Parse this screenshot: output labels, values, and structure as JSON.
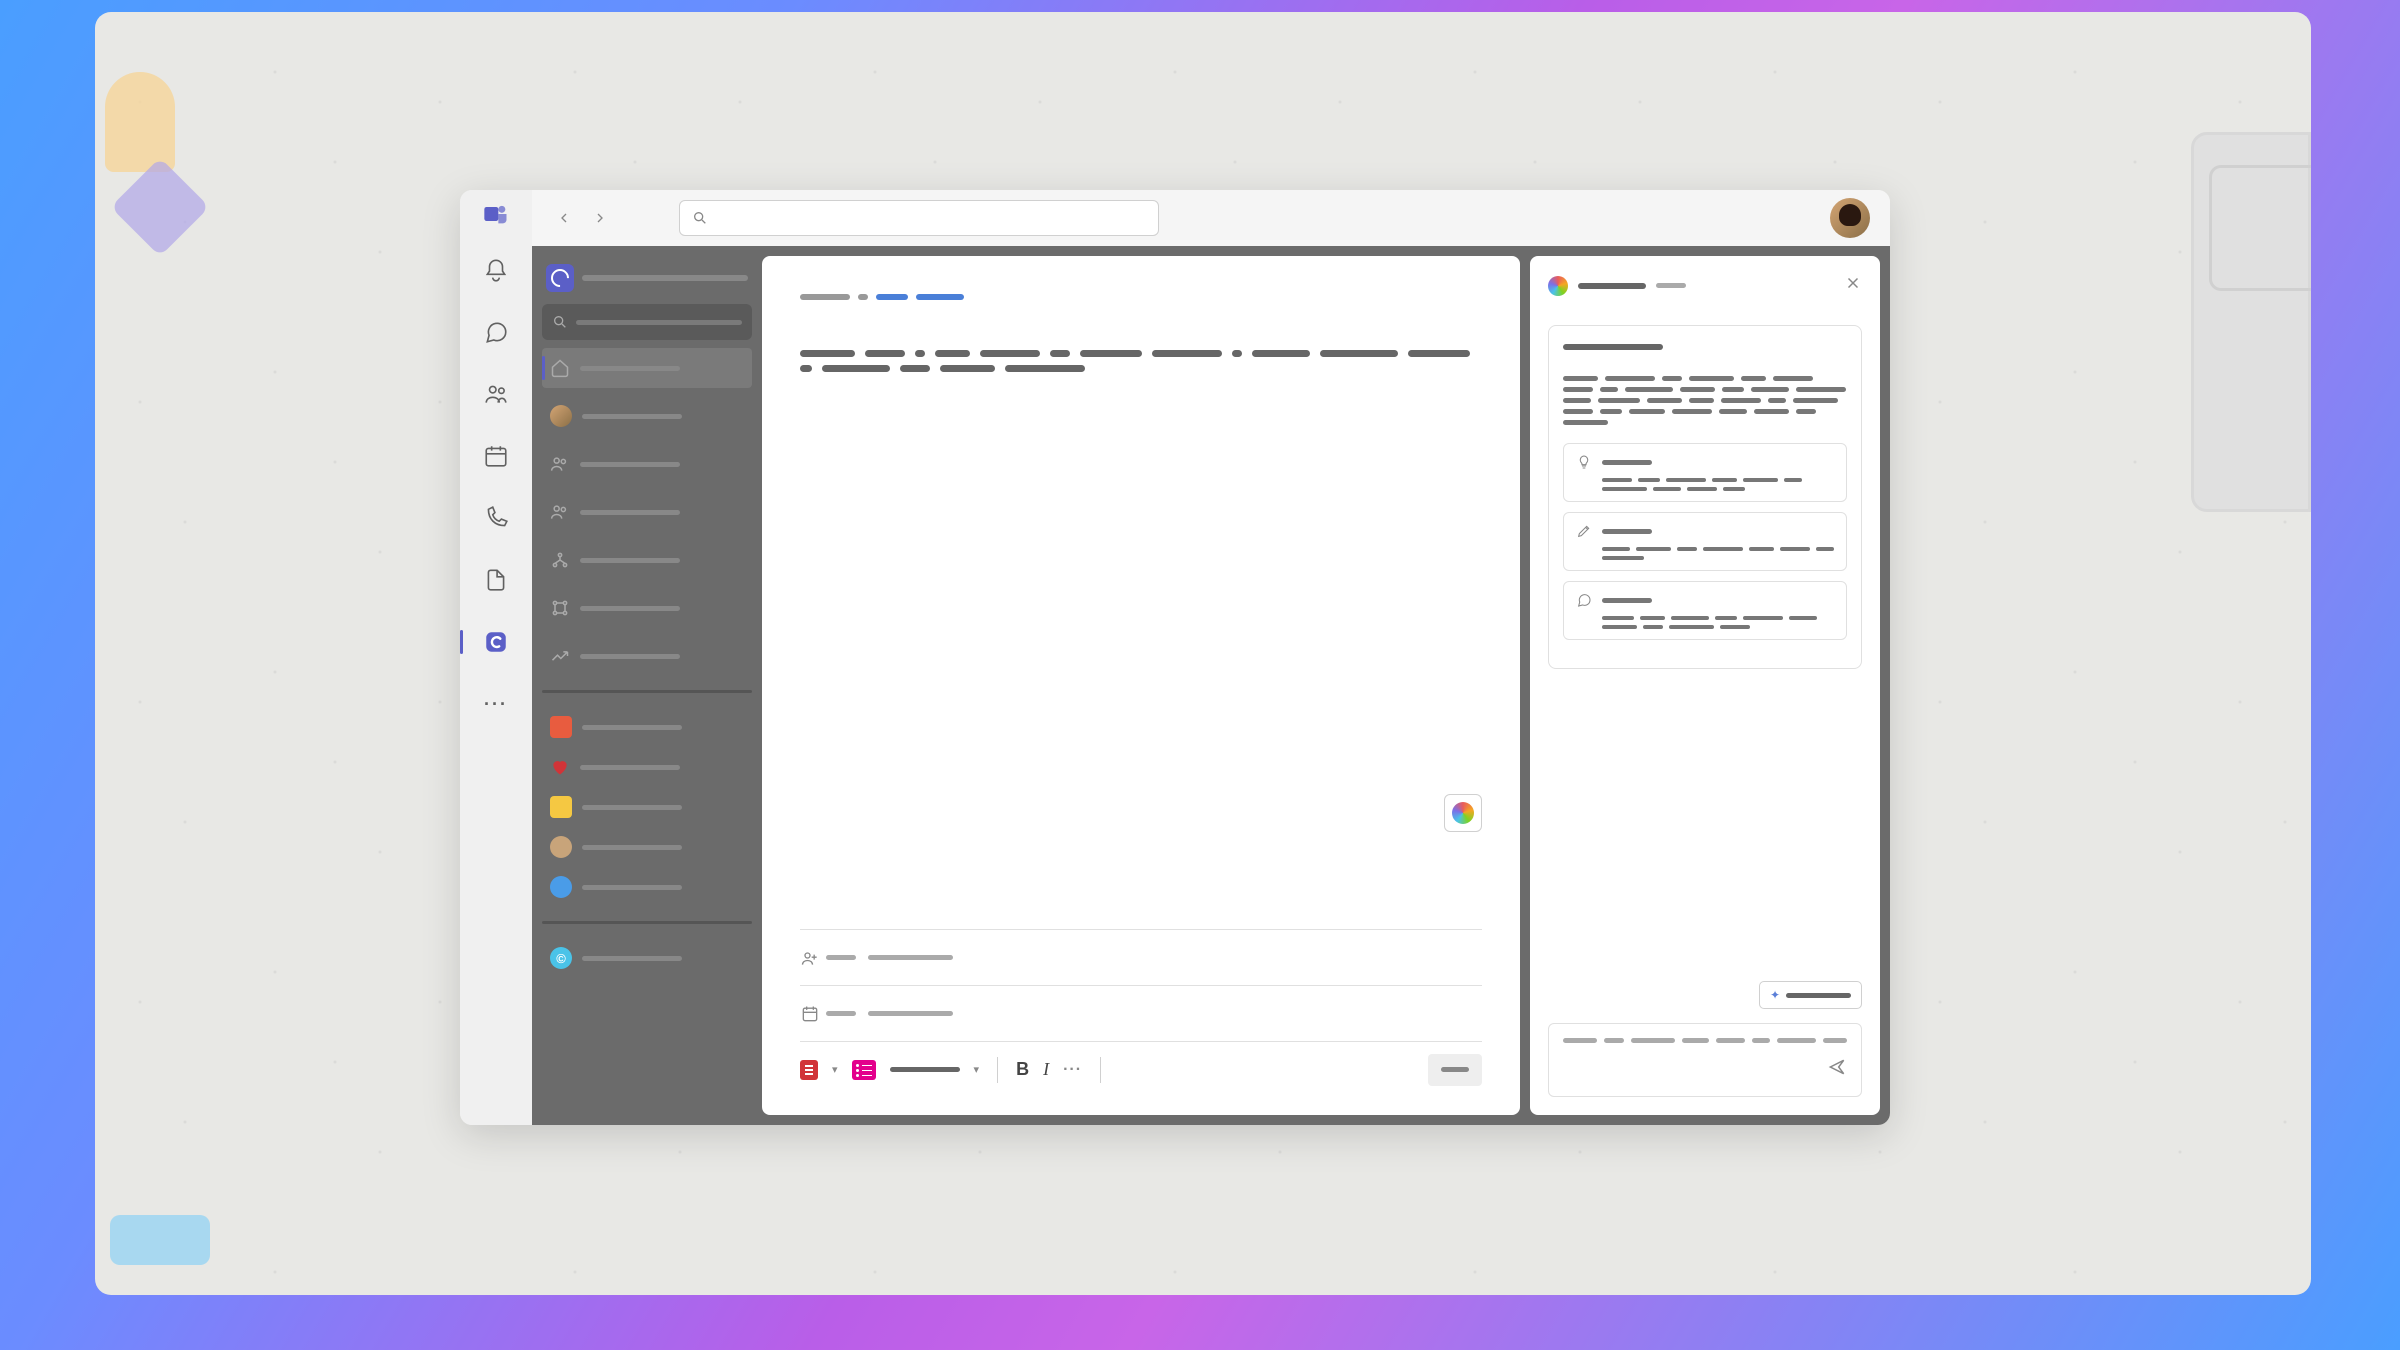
{
  "rail": {
    "items": [
      "activity",
      "chat",
      "teams",
      "calendar",
      "calls",
      "files",
      "loop",
      "more"
    ],
    "active": "loop"
  },
  "titlebar": {
    "search_placeholder": ""
  },
  "side": {
    "main_items": [
      "home",
      "avatar-1",
      "group-1",
      "group-2",
      "org",
      "nodes",
      "trend"
    ],
    "selected": "home",
    "secondary": [
      {
        "type": "sq",
        "color": "#e85c3f"
      },
      {
        "type": "heart",
        "color": "#d13438"
      },
      {
        "type": "sq",
        "color": "#f5c842"
      },
      {
        "type": "av",
        "color": "#c8a47a"
      },
      {
        "type": "circ",
        "color": "#4a9ce8"
      }
    ]
  },
  "editor": {
    "breadcrumbs": 4,
    "body_words": [
      55,
      40,
      10,
      35,
      60,
      20,
      62,
      70,
      10,
      58,
      78,
      62,
      12,
      68,
      30,
      55,
      80
    ],
    "meta1_label": "",
    "meta2_label": "",
    "toolbar": {
      "bold": "B",
      "italic": "I"
    }
  },
  "copilot": {
    "title": "",
    "subtitle": "",
    "intro_words": [
      35,
      50,
      20,
      45,
      25,
      40,
      30,
      18,
      48,
      35,
      22,
      38,
      50,
      28,
      42,
      35,
      25,
      40,
      18,
      45,
      30,
      22,
      36,
      40,
      28,
      35,
      20,
      45
    ],
    "suggestions": [
      {
        "icon": "bulb",
        "body": [
          30,
          22,
          40,
          25,
          35,
          18,
          45,
          28,
          30,
          22
        ]
      },
      {
        "icon": "pencil",
        "body": [
          28,
          35,
          20,
          40,
          25,
          30,
          18,
          42
        ]
      },
      {
        "icon": "chat",
        "body": [
          32,
          25,
          38,
          22,
          40,
          28,
          35,
          20,
          45,
          30
        ]
      }
    ],
    "input_words": [
      35,
      20,
      45,
      28,
      30,
      18,
      40,
      25
    ]
  }
}
